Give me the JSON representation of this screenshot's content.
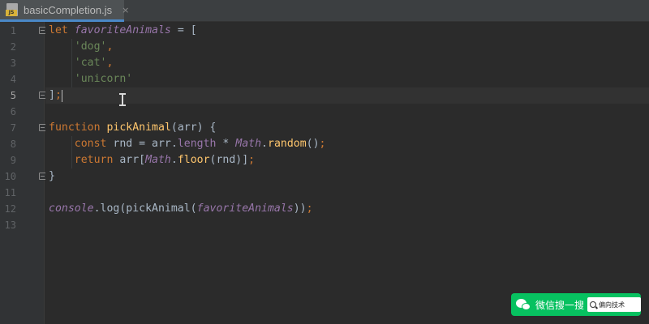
{
  "tab": {
    "file_name": "basicCompletion.js",
    "icon": "js-file-icon",
    "close_glyph": "×"
  },
  "gutter": {
    "line_numbers": [
      "1",
      "2",
      "3",
      "4",
      "5",
      "6",
      "7",
      "8",
      "9",
      "10",
      "11",
      "12",
      "13"
    ],
    "current_line": "5"
  },
  "code": {
    "l1": {
      "kw": "let",
      "var": "favoriteAnimals",
      "rest": " = ["
    },
    "l2": {
      "indent": "    ",
      "str": "'dog'",
      "comma": ","
    },
    "l3": {
      "indent": "    ",
      "str": "'cat'",
      "comma": ","
    },
    "l4": {
      "indent": "    ",
      "str": "'unicorn'"
    },
    "l5": {
      "bracket": "]",
      "semi": ";"
    },
    "l7": {
      "kw": "function",
      "fn": "pickAnimal",
      "rest": "(arr) {"
    },
    "l8": {
      "indent": "    ",
      "kw": "const",
      "a": " rnd = arr.",
      "prop": "length",
      "b": " * ",
      "math": "Math",
      "c": ".",
      "fn": "random",
      "d": "()",
      "semi": ";"
    },
    "l9": {
      "indent": "    ",
      "kw": "return",
      "a": " arr[",
      "math": "Math",
      "b": ".",
      "fn": "floor",
      "c": "(rnd)]",
      "semi": ";"
    },
    "l10": {
      "brace": "}"
    },
    "l12": {
      "console": "console",
      "a": ".log(pickAnimal(",
      "var": "favoriteAnimals",
      "b": "))",
      "semi": ";"
    }
  },
  "watermark": {
    "label": "微信搜一搜",
    "query": "偏向技术",
    "icon": "wechat-icon",
    "search_icon": "search-icon",
    "color": "#07c160"
  },
  "colors": {
    "keyword": "#cc7832",
    "string": "#6a8759",
    "function": "#ffc66d",
    "variable": "#9876aa",
    "text": "#a9b7c6",
    "background": "#2b2b2b"
  }
}
